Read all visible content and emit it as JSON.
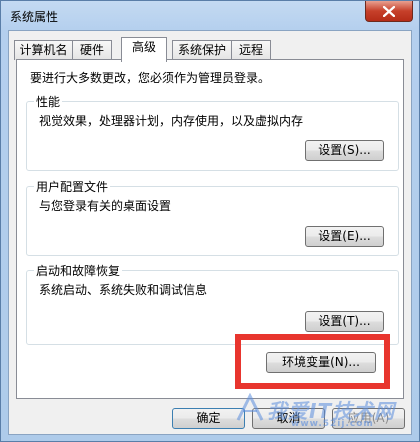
{
  "window": {
    "title": "系统属性",
    "close_icon": "close-icon"
  },
  "tabs": [
    {
      "label": "计算机名",
      "active": false
    },
    {
      "label": "硬件",
      "active": false
    },
    {
      "label": "高级",
      "active": true
    },
    {
      "label": "系统保护",
      "active": false
    },
    {
      "label": "远程",
      "active": false
    }
  ],
  "advanced": {
    "intro": "要进行大多数更改，您必须作为管理员登录。",
    "performance": {
      "title": "性能",
      "description": "视觉效果，处理器计划，内存使用，以及虚拟内存",
      "button": "设置(S)..."
    },
    "user_profiles": {
      "title": "用户配置文件",
      "description": "与您登录有关的桌面设置",
      "button": "设置(E)..."
    },
    "startup_recovery": {
      "title": "启动和故障恢复",
      "description": "系统启动、系统失败和调试信息",
      "button": "设置(T)..."
    },
    "env_button": "环境变量(N)..."
  },
  "footer": {
    "ok": "确定",
    "cancel": "取消",
    "apply": "应用(A)"
  },
  "watermark": {
    "text": "我爱IT技术网",
    "url": "www.52ij.com"
  },
  "colors": {
    "highlight": "#e8352e",
    "close_button": "#c6402a"
  }
}
